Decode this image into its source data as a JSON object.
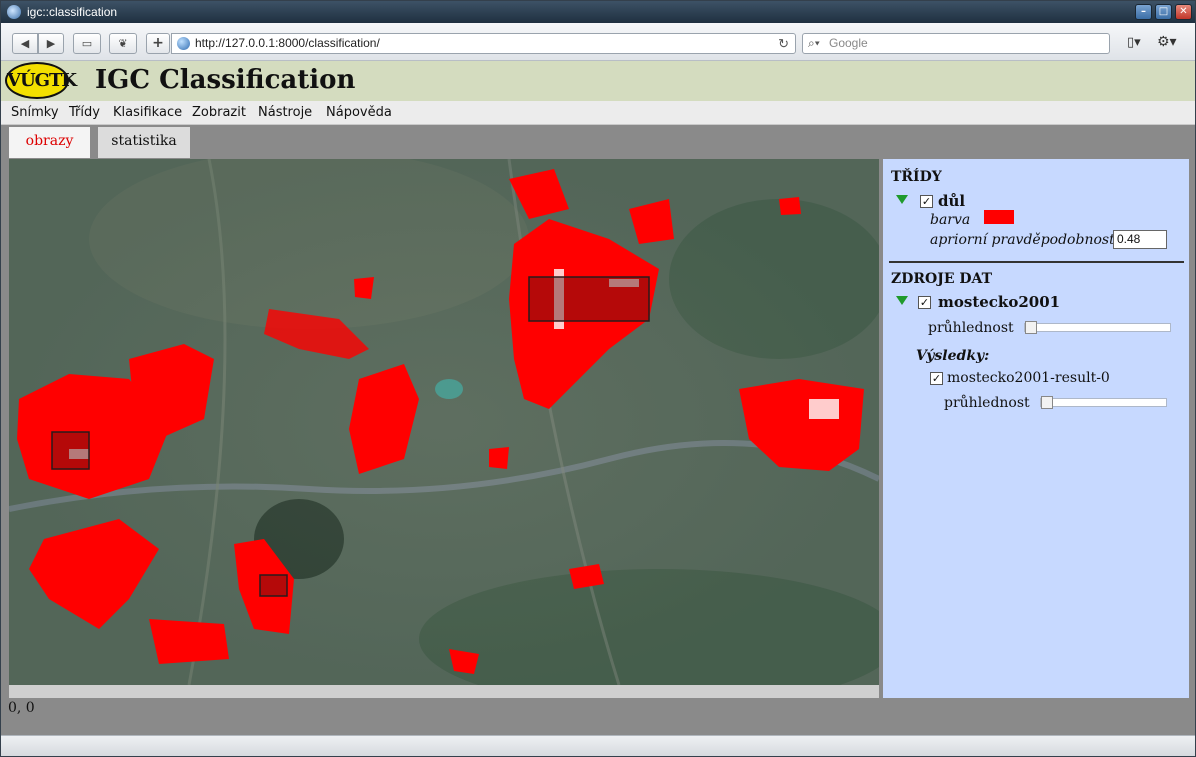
{
  "window": {
    "title": "igc::classification",
    "min_label": "–",
    "max_label": "□",
    "close_label": "✕"
  },
  "browser": {
    "back_label": "◀",
    "forward_label": "▶",
    "bookmarks_label": "▭",
    "leaf_label": "❦",
    "new_tab_label": "+",
    "url": "http://127.0.0.1:8000/classification/",
    "reload_label": "↻",
    "search_placeholder": "Google",
    "search_icon_label": "🔍",
    "page_menu_label": "▯▾",
    "tools_menu_label": "⚙▾"
  },
  "app": {
    "logo_text": "VÚGTK",
    "title": "IGC Classification"
  },
  "menu": {
    "items": [
      "Snímky",
      "Třídy",
      "Klasifikace",
      "Zobrazit",
      "Nástroje",
      "Nápověda"
    ]
  },
  "tabs": [
    {
      "label": "obrazy",
      "active": true
    },
    {
      "label": "statistika",
      "active": false
    }
  ],
  "panel": {
    "classes_title": "TŘÍDY",
    "class_item": {
      "name": "důl",
      "checked": true,
      "color_label": "barva",
      "color": "#ff0000",
      "prior_label": "apriorní pravděpodobnost",
      "prior_value": "0.48"
    },
    "sources_title": "ZDROJE DAT",
    "source_item": {
      "name": "mostecko2001",
      "checked": true,
      "opacity_label": "průhlednost",
      "opacity_value": 0,
      "results_title": "Výsledky:",
      "result_name": "mostecko2001-result-0",
      "result_checked": true,
      "result_opacity_label": "průhlednost",
      "result_opacity_value": 0
    },
    "check_mark": "✓"
  },
  "status": {
    "coords": "0, 0"
  },
  "colors": {
    "classification_overlay": "#ff0000",
    "panel_bg": "#c7d9ff",
    "header_bg": "#d4dcbf",
    "active_tab_text": "#dd0000",
    "expand_triangle": "#1f9a2c"
  }
}
